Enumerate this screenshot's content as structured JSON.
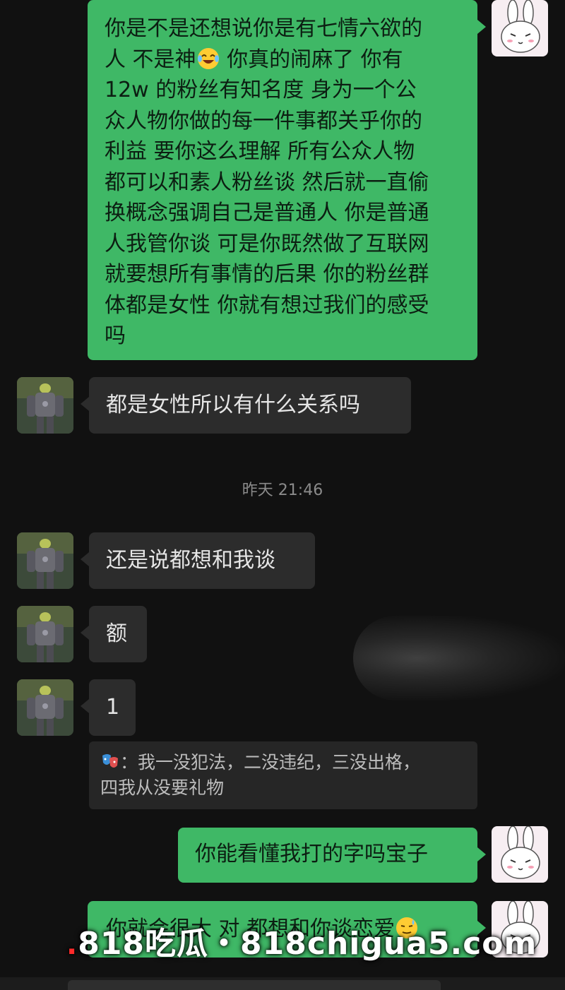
{
  "messages": {
    "m1_lines": [
      "你是不是还想说你是有七情六欲的",
      "人 不是神",
      " 你真的闹麻了 你有",
      "12w 的粉丝有知名度 身为一个公",
      "众人物你做的每一件事都关乎你的",
      "利益 要你这么理解 所有公众人物",
      "都可以和素人粉丝谈 然后就一直偷",
      "换概念强调自己是普通人 你是普通",
      "人我管你谈 可是你既然做了互联网",
      "就要想所有事情的后果 你的粉丝群",
      "体都是女性 你就有想过我们的感受",
      "吗"
    ],
    "m2": "都是女性所以有什么关系吗",
    "m3": "还是说都想和我谈",
    "m4": "额",
    "m5": "1",
    "m6": "你能看懂我打的字吗宝子",
    "m7": "你就会很大 对 都想和你谈恋爱"
  },
  "timestamp": "昨天 21:46",
  "quote": {
    "line1": "：我一没犯法，二没违纪，三没出格，",
    "line2": "四我从没要礼物"
  },
  "watermark": {
    "dot": ".",
    "text": "818吃瓜・818chigua5.com"
  },
  "emoji": {
    "laugh": "laugh-cry-emoji",
    "sweat": "sweat-smile-emoji"
  },
  "colors": {
    "outgoing_bubble": "#3fb866",
    "incoming_bubble": "#2c2c2c",
    "background": "#111111"
  }
}
